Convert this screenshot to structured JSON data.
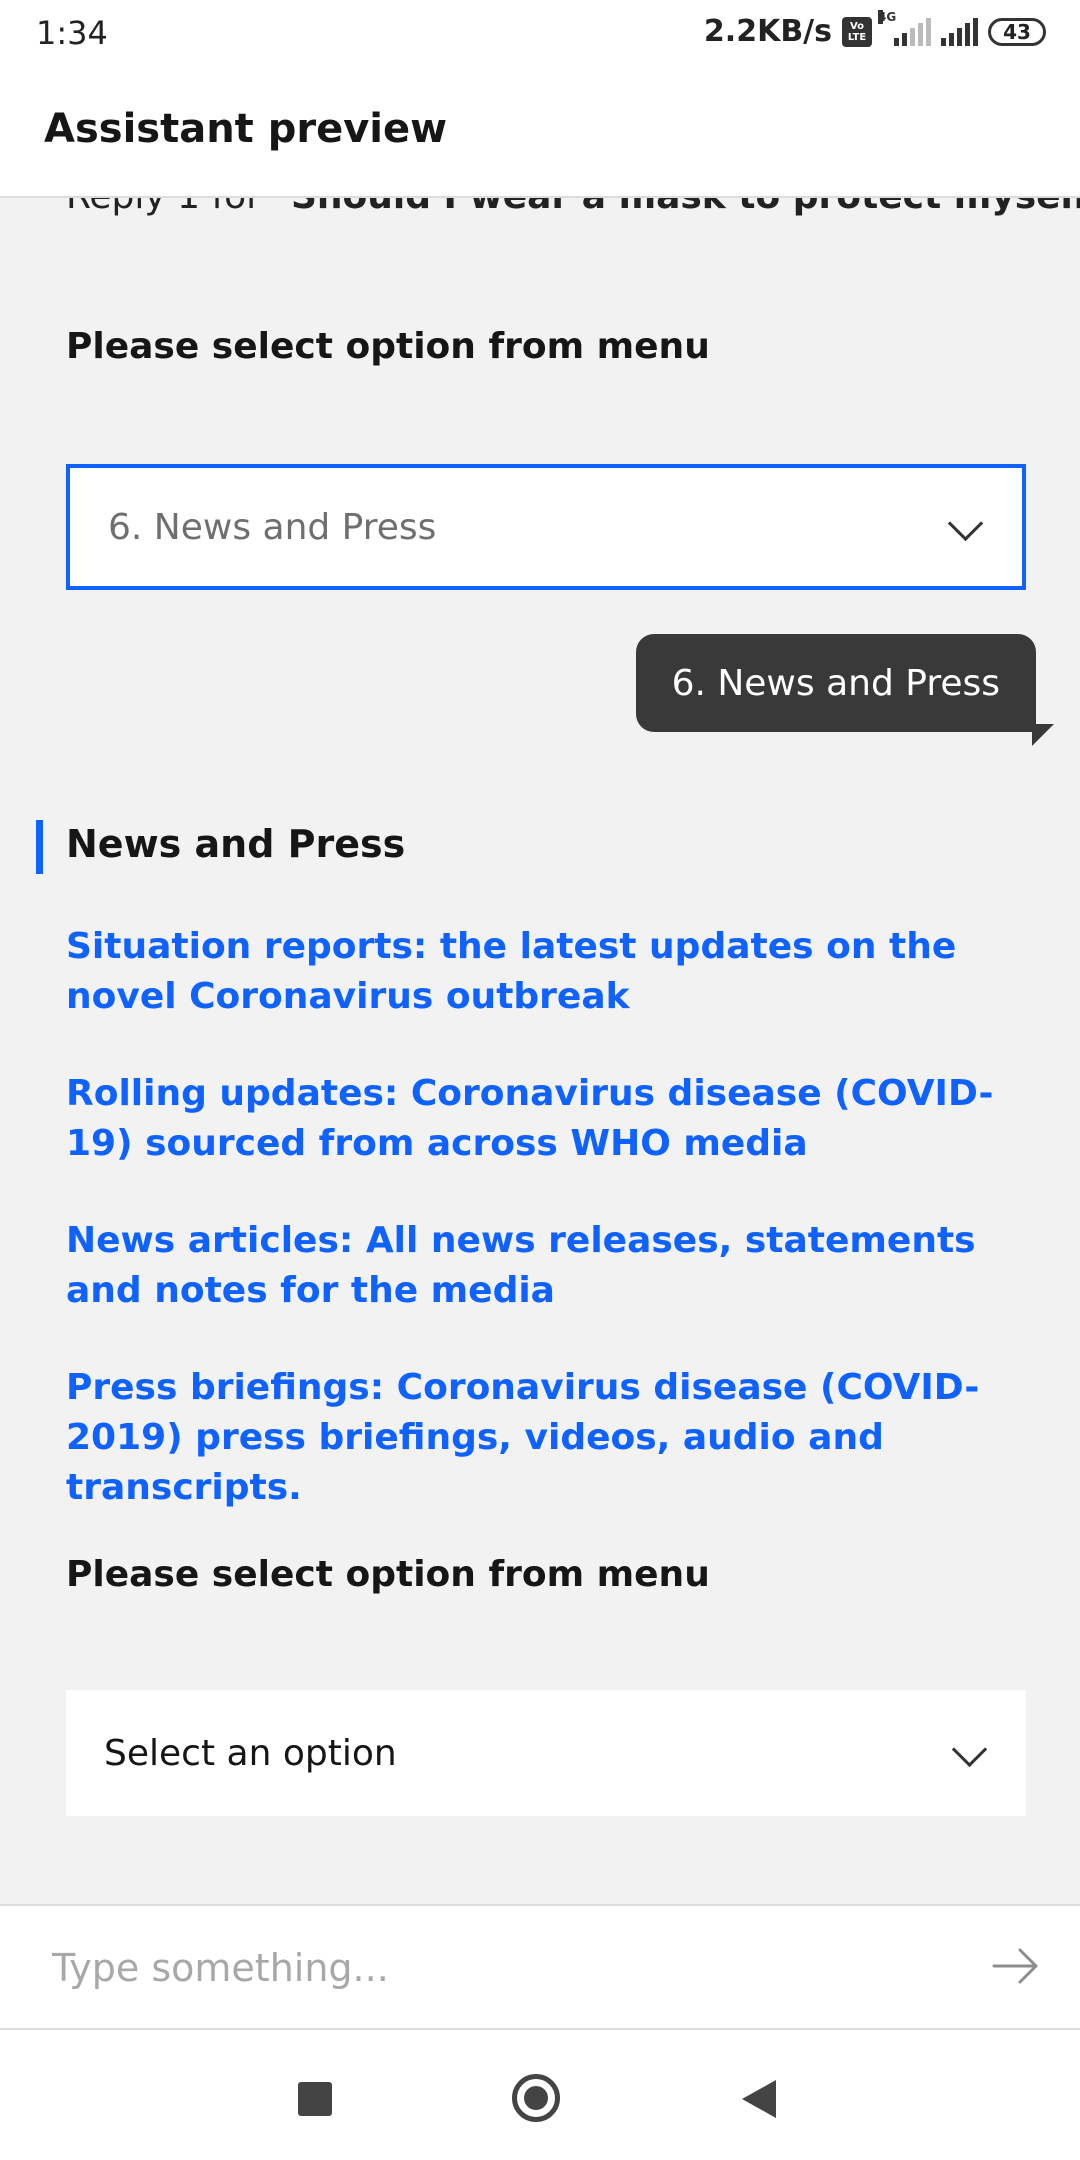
{
  "status_bar": {
    "time": "1:34",
    "net_speed": "2.2KB/s",
    "volte_top": "Vo",
    "volte_bottom": "LTE",
    "network": "4G",
    "battery": "43"
  },
  "header": {
    "title": "Assistant preview"
  },
  "chat": {
    "prior_reply_prefix": "Reply 1 for",
    "prior_reply_option": "Should I wear a mask to protect myself?",
    "prompt_1": "Please select option from menu",
    "dropdown_1_value": "6. News and Press",
    "user_message": "6. News and Press",
    "section_title": "News and Press",
    "links": [
      "Situation reports: the latest updates on the novel Coronavirus outbreak",
      "Rolling updates: Coronavirus disease (COVID-19) sourced from across WHO media",
      "News articles: All news releases, statements and notes for the media",
      "Press briefings: Coronavirus disease (COVID-2019) press briefings, videos, audio and transcripts."
    ],
    "prompt_2": "Please select option from menu",
    "dropdown_2_value": "Select an option"
  },
  "input": {
    "placeholder": "Type something..."
  },
  "colors": {
    "accent": "#0f62fe",
    "bubble": "#393939",
    "background": "#f2f2f2"
  },
  "icons": [
    "chevron-down-icon",
    "send-arrow-icon",
    "recent-apps-icon",
    "home-icon",
    "back-icon"
  ]
}
